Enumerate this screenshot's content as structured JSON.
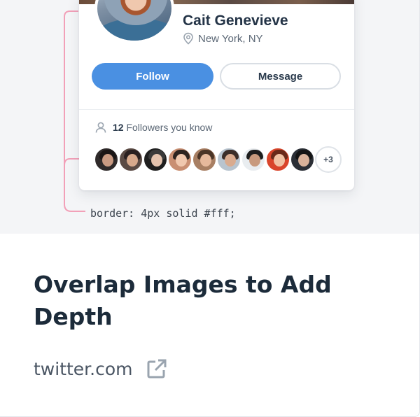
{
  "profile": {
    "name": "Cait Genevieve",
    "location": "New York, NY",
    "follow_label": "Follow",
    "message_label": "Message",
    "followers_count": "12",
    "followers_text": "Followers you know",
    "more_count": "+3"
  },
  "annotation": {
    "code": "border: 4px solid #fff;"
  },
  "article": {
    "title": "Overlap Images to Add Depth",
    "source": "twitter.com"
  },
  "colors": {
    "accent": "#4a90e2",
    "annotation": "#f2a0b8",
    "title": "#1c2b3a"
  },
  "icons": {
    "location": "map-pin-icon",
    "followers": "user-icon",
    "external": "external-link-icon"
  }
}
